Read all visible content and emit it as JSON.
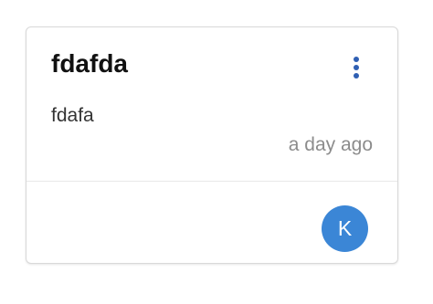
{
  "card": {
    "title": "fdafda",
    "body": "fdafa",
    "timestamp": "a day ago",
    "menu_icon": "more-vertical-icon",
    "avatar_initial": "K",
    "avatar_color": "#3b86d6",
    "accent_color": "#2f5fb3"
  }
}
